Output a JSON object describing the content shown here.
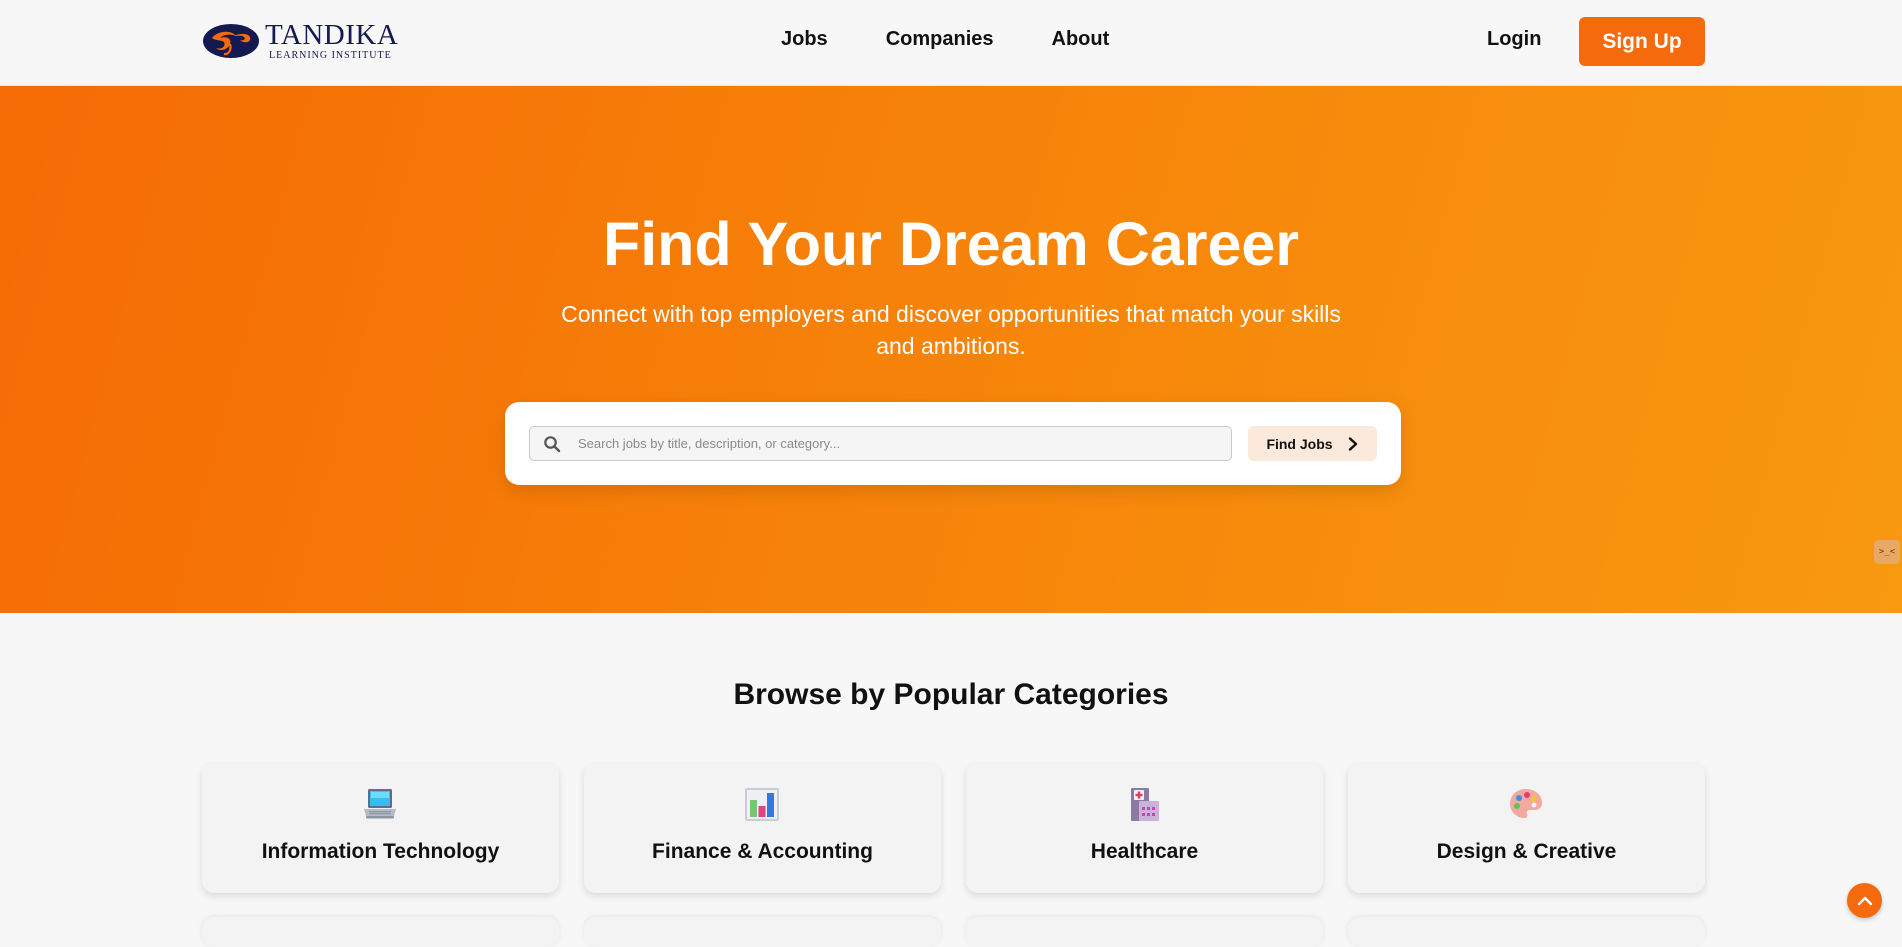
{
  "brand": {
    "name": "TANDIKA",
    "subtitle": "LEARNING INSTITUTE",
    "primary_color": "#f46a0c",
    "navy_color": "#141a4f"
  },
  "nav": {
    "items": [
      {
        "label": "Jobs"
      },
      {
        "label": "Companies"
      },
      {
        "label": "About"
      }
    ],
    "login_label": "Login",
    "signup_label": "Sign Up"
  },
  "hero": {
    "title": "Find Your Dream Career",
    "subtitle": "Connect with top employers and discover opportunities that match your skills and ambitions.",
    "search": {
      "placeholder": "Search jobs by title, description, or category...",
      "value": "",
      "button_label": "Find Jobs"
    },
    "side_widget_label": ">_<"
  },
  "categories": {
    "title": "Browse by Popular Categories",
    "items": [
      {
        "label": "Information Technology",
        "icon": "laptop-icon"
      },
      {
        "label": "Finance & Accounting",
        "icon": "bar-chart-icon"
      },
      {
        "label": "Healthcare",
        "icon": "hospital-icon"
      },
      {
        "label": "Design & Creative",
        "icon": "palette-icon"
      }
    ]
  }
}
